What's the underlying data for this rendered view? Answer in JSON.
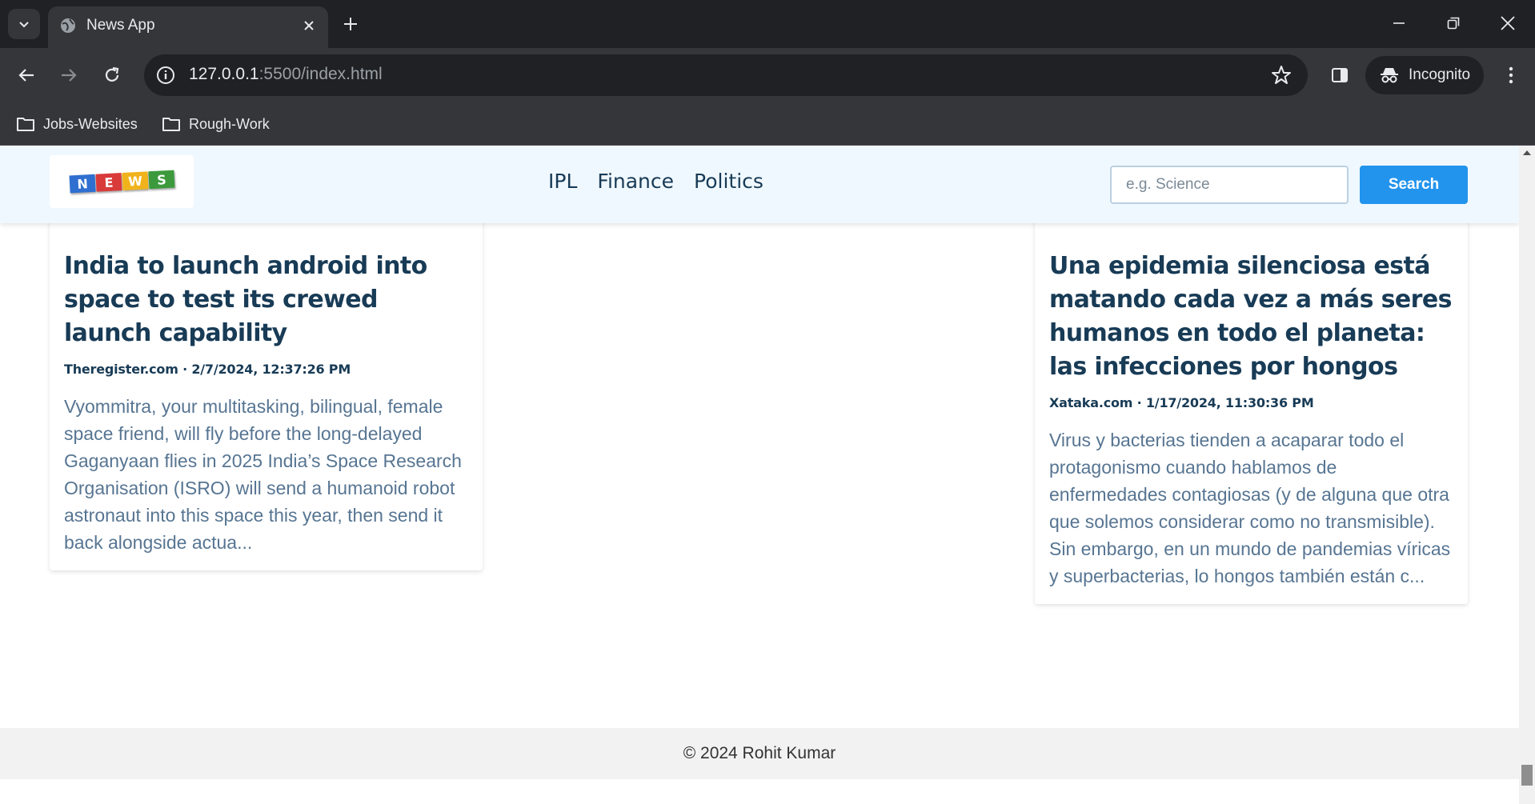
{
  "browser": {
    "tab_title": "News App",
    "url_host": "127.0.0.1",
    "url_path": ":5500/index.html",
    "incognito_label": "Incognito",
    "bookmarks": [
      {
        "label": "Jobs-Websites",
        "icon": "folder-icon"
      },
      {
        "label": "Rough-Work",
        "icon": "folder-icon"
      }
    ]
  },
  "site": {
    "logo_letters": [
      "N",
      "E",
      "W",
      "S"
    ],
    "logo_colors": [
      "#2f6fd0",
      "#d93a3a",
      "#f1b31c",
      "#3c9a3c"
    ],
    "nav_links": [
      "IPL",
      "Finance",
      "Politics"
    ],
    "search_placeholder": "e.g. Science",
    "search_button": "Search"
  },
  "cards": [
    {
      "title": "India to launch android into space to test its crewed launch capability",
      "meta": "Theregister.com · 2/7/2024, 12:37:26 PM",
      "description": "Vyommitra, your multitasking, bilingual, female space friend, will fly before the long-delayed Gaganyaan flies in 2025 India’s Space Research Organisation (ISRO) will send a humanoid robot astronaut into this space this year, then send it back alongside actua..."
    },
    {
      "title": "Una epidemia silenciosa está matando cada vez a más seres humanos en todo el planeta: las infecciones por hongos",
      "meta": "Xataka.com · 1/17/2024, 11:30:36 PM",
      "description": "Virus y bacterias tienden a acaparar todo el protagonismo cuando hablamos de enfermedades contagiosas (y de alguna que otra que solemos considerar como no transmisible). Sin embargo, en un mundo de pandemias víricas y superbacterias, lo hongos también están c..."
    }
  ],
  "footer": "© 2024 Rohit Kumar"
}
